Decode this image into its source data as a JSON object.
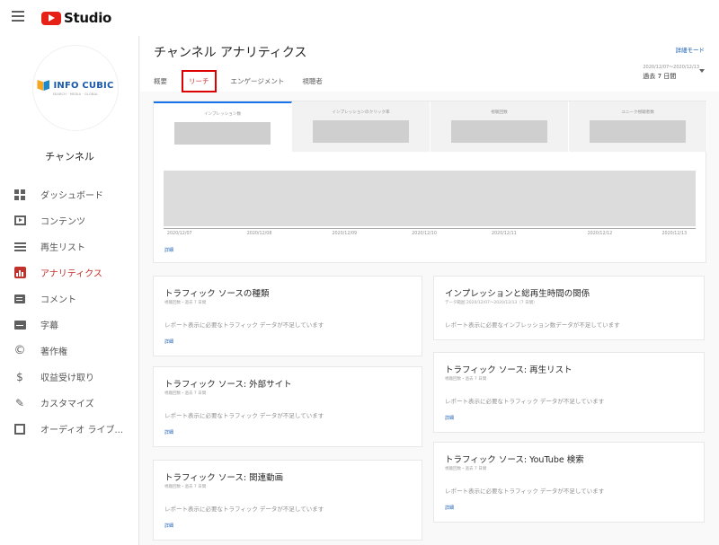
{
  "app": {
    "logo_text": "Studio"
  },
  "sidebar": {
    "brand_name": "INFO CUBIC",
    "brand_sub": "SEARCH · MEDIA · GLOBAL",
    "channel_name": "チャンネル",
    "items": [
      {
        "label": "ダッシュボード",
        "icon": "dashboard-icon"
      },
      {
        "label": "コンテンツ",
        "icon": "content-icon"
      },
      {
        "label": "再生リスト",
        "icon": "playlist-icon"
      },
      {
        "label": "アナリティクス",
        "icon": "analytics-icon"
      },
      {
        "label": "コメント",
        "icon": "comment-icon"
      },
      {
        "label": "字幕",
        "icon": "subtitles-icon"
      },
      {
        "label": "著作権",
        "icon": "copyright-icon"
      },
      {
        "label": "収益受け取り",
        "icon": "monetization-icon"
      },
      {
        "label": "カスタマイズ",
        "icon": "customize-icon"
      },
      {
        "label": "オーディオ ライブ...",
        "icon": "audio-library-icon"
      }
    ],
    "active_color": "#c4302b"
  },
  "header": {
    "title": "チャンネル アナリティクス",
    "detail_mode": "詳細モード",
    "tabs": [
      "概要",
      "リーチ",
      "エンゲージメント",
      "視聴者"
    ],
    "selected_tab": "リーチ",
    "date_range": "2020/12/07～2020/12/13",
    "date_label": "過去 7 日間"
  },
  "chart": {
    "metrics": [
      "インプレッション数",
      "インプレッションのクリック率",
      "視聴回数",
      "ユニーク視聴者数"
    ],
    "x_labels": [
      "2020/12/07",
      "2020/12/08",
      "2020/12/09",
      "2020/12/10",
      "2020/12/11",
      "2020/12/12",
      "2020/12/13"
    ],
    "link": "詳細"
  },
  "cards": {
    "traffic_types": {
      "title": "トラフィック ソースの種類",
      "sub": "視聴回数・過去 7 日間",
      "message": "レポート表示に必要なトラフィック データが不足しています",
      "link": "詳細"
    },
    "external": {
      "title": "トラフィック ソース: 外部サイト",
      "sub": "視聴回数・過去 7 日間",
      "message": "レポート表示に必要なトラフィック データが不足しています",
      "link": "詳細"
    },
    "related": {
      "title": "トラフィック ソース: 関連動画",
      "sub": "視聴回数・過去 7 日間",
      "message": "レポート表示に必要なトラフィック データが不足しています",
      "link": "詳細"
    },
    "impressions": {
      "title": "インプレッションと総再生時間の関係",
      "sub": "データ範囲 2020/12/07～2020/12/13（7 日間）",
      "message": "レポート表示に必要なインプレッション数データが不足しています"
    },
    "playlist": {
      "title": "トラフィック ソース: 再生リスト",
      "sub": "視聴回数・過去 7 日間",
      "message": "レポート表示に必要なトラフィック データが不足しています",
      "link": "詳細"
    },
    "youtube_search": {
      "title": "トラフィック ソース: YouTube 検索",
      "sub": "視聴回数・過去 7 日間",
      "message": "レポート表示に必要なトラフィック データが不足しています",
      "link": "詳細"
    }
  }
}
